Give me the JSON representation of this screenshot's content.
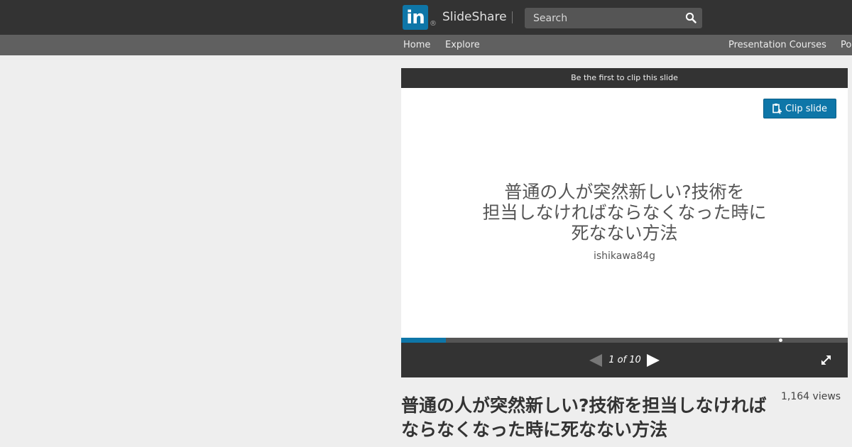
{
  "header": {
    "logo_text": "in",
    "logo_mark": "®",
    "brand": "SlideShare",
    "search_placeholder": "Search",
    "search_icon": "search-icon"
  },
  "nav": {
    "home": "Home",
    "explore": "Explore",
    "presentation_courses": "Presentation Courses",
    "partial_item": "Po"
  },
  "player": {
    "clip_banner": "Be the first to clip this slide",
    "clip_button": "Clip slide",
    "slide_title": "普通の人が突然新しい?技術を\n担当しなければならなくなった時に\n死なない方法",
    "slide_author": "ishikawa84g",
    "current_page": 1,
    "total_pages": 10,
    "page_indicator": "1 of 10",
    "progress_fraction": 0.1,
    "marker_fraction": 0.85
  },
  "details": {
    "title": "普通の人が突然新しい?技術を担当しなければならなくなった時に死なない方法",
    "views": "1,164 views"
  },
  "colors": {
    "topbar": "#333333",
    "subnav": "#606060",
    "accent": "#0e76a8",
    "page_bg": "#eeeeee"
  }
}
